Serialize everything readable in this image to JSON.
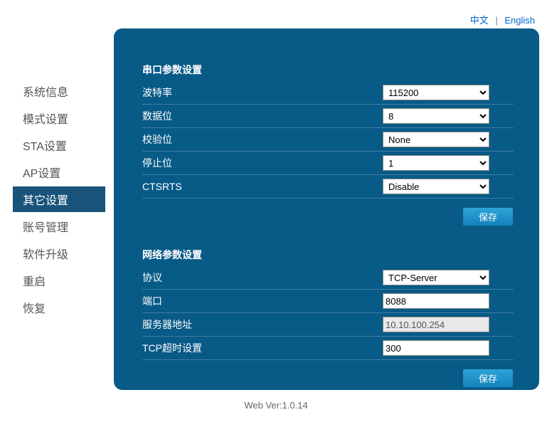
{
  "lang": {
    "zh": "中文",
    "en": "English"
  },
  "sidebar": {
    "items": [
      {
        "label": "系统信息"
      },
      {
        "label": "模式设置"
      },
      {
        "label": "STA设置"
      },
      {
        "label": "AP设置"
      },
      {
        "label": "其它设置"
      },
      {
        "label": "账号管理"
      },
      {
        "label": "软件升级"
      },
      {
        "label": "重启"
      },
      {
        "label": "恢复"
      }
    ]
  },
  "serial": {
    "title": "串口参数设置",
    "rows": {
      "baud": {
        "label": "波特率",
        "value": "115200"
      },
      "data": {
        "label": "数据位",
        "value": "8"
      },
      "parity": {
        "label": "校验位",
        "value": "None"
      },
      "stop": {
        "label": "停止位",
        "value": "1"
      },
      "ctsrts": {
        "label": "CTSRTS",
        "value": "Disable"
      }
    },
    "save": "保存"
  },
  "net": {
    "title": "网络参数设置",
    "rows": {
      "proto": {
        "label": "协议",
        "value": "TCP-Server"
      },
      "port": {
        "label": "端口",
        "value": "8088"
      },
      "server": {
        "label": "服务器地址",
        "value": "10.10.100.254"
      },
      "timeout": {
        "label": "TCP超时设置",
        "value": "300"
      }
    },
    "save": "保存"
  },
  "footer": "Web Ver:1.0.14"
}
